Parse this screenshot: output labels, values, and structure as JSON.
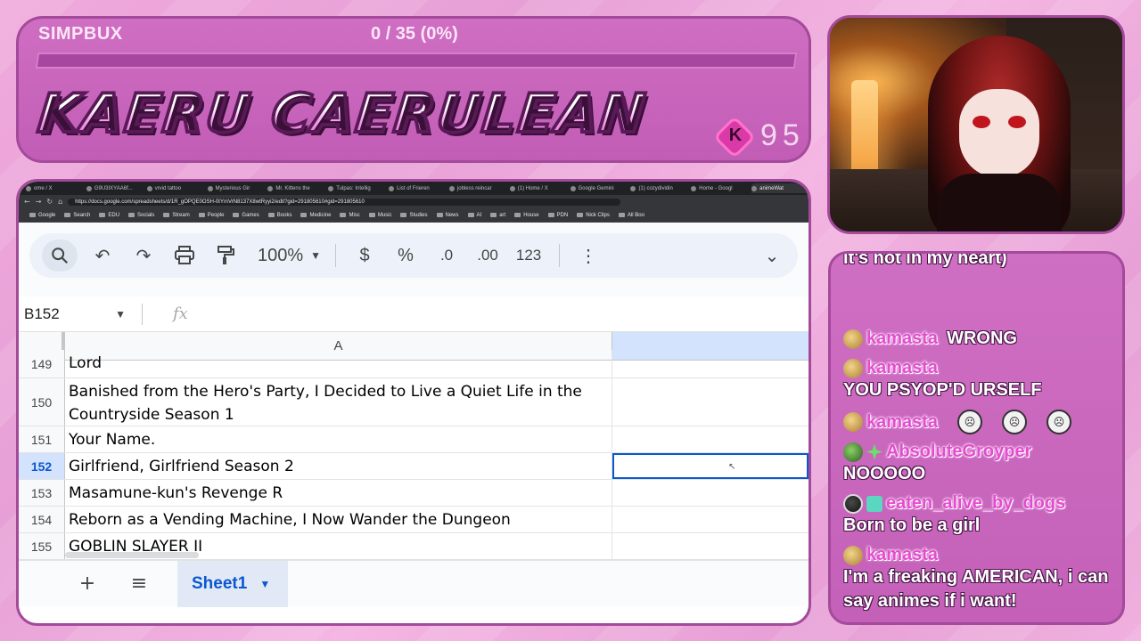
{
  "overlay": {
    "currency_label": "SIMPBUX",
    "goal_progress": "0 / 35 (0%)",
    "goal_fraction": 0.0,
    "streamer_name": "KAERU CAERULEAN",
    "coin_letter": "K",
    "coin_count": "95"
  },
  "browser": {
    "tabs": [
      "ome / X",
      "G9U3IXYAA6f...",
      "vrvid tattoo",
      "Mysterious Gir",
      "Mr. Kittens the",
      "Tulpas: Intellig",
      "List of Frieren",
      "jobless reincar",
      "(1) Home / X",
      "Google Gemini",
      "(1) cozydividin",
      "Home - Googl",
      "animeWat"
    ],
    "active_tab_index": 12,
    "url": "https://docs.google.com/spreadsheets/d/1R_gOPQE0OSH-0tYmVrN8137X8wtRyyi2/edit?gid=291805610#gid=291805610",
    "bookmarks": [
      "Google",
      "Search",
      "EDU",
      "Socials",
      "Stream",
      "People",
      "Games",
      "Books",
      "Medicine",
      "Misc",
      "Music",
      "Studies",
      "News",
      "AI",
      "art",
      "House",
      "PDN",
      "Nick Clips",
      "All Boo"
    ]
  },
  "sheet": {
    "toolbar": {
      "search_icon": "magnifier-icon",
      "undo": "↶",
      "redo": "↷",
      "zoom": "100%",
      "currency": "$",
      "percent": "%",
      "decrease_decimal": ".0",
      "increase_decimal": ".00",
      "number_format": "123",
      "more": "⋮",
      "collapse": "⌄"
    },
    "name_box": "B152",
    "fx_label": "fx",
    "column_a": "A",
    "rows": [
      {
        "num": "149",
        "a": "Lord",
        "selected": false,
        "height": 32
      },
      {
        "num": "150",
        "a": "Banished from the Hero's Party, I Decided to Live a Quiet Life in the Countryside Season 1",
        "selected": false,
        "height": 54
      },
      {
        "num": "151",
        "a": "Your Name.",
        "selected": false,
        "height": 30
      },
      {
        "num": "152",
        "a": "Girlfriend, Girlfriend Season 2",
        "selected": true,
        "height": 30
      },
      {
        "num": "153",
        "a": "Masamune-kun's Revenge R",
        "selected": false,
        "height": 30
      },
      {
        "num": "154",
        "a": "Reborn as a Vending Machine, I Now Wander the Dungeon",
        "selected": false,
        "height": 30
      },
      {
        "num": "155",
        "a": "GOBLIN SLAYER II",
        "selected": false,
        "height": 30
      }
    ],
    "sheet_tab": "Sheet1",
    "add_sheet": "+",
    "all_sheets": "≡"
  },
  "chat": {
    "top_cut_text": "it's not in my heart)",
    "messages": [
      {
        "user": "kamasta",
        "text": "WRONG",
        "inline": true,
        "badge": "gold"
      },
      {
        "user": "kamasta",
        "text": "YOU PSYOP'D URSELF",
        "inline": false,
        "badge": "gold"
      },
      {
        "user": "kamasta",
        "text": "",
        "inline": true,
        "badge": "gold",
        "emotes": 3
      },
      {
        "user": "AbsoluteGroyper",
        "text": "NOOOOO",
        "inline": false,
        "badge": "green"
      },
      {
        "user": "eaten_alive_by_dogs",
        "text": "Born to be a girl",
        "inline": false,
        "badge": "dark"
      },
      {
        "user": "kamasta",
        "text": "I'm a freaking AMERICAN, i can say animes if i want!",
        "inline": false,
        "badge": "gold"
      }
    ]
  }
}
